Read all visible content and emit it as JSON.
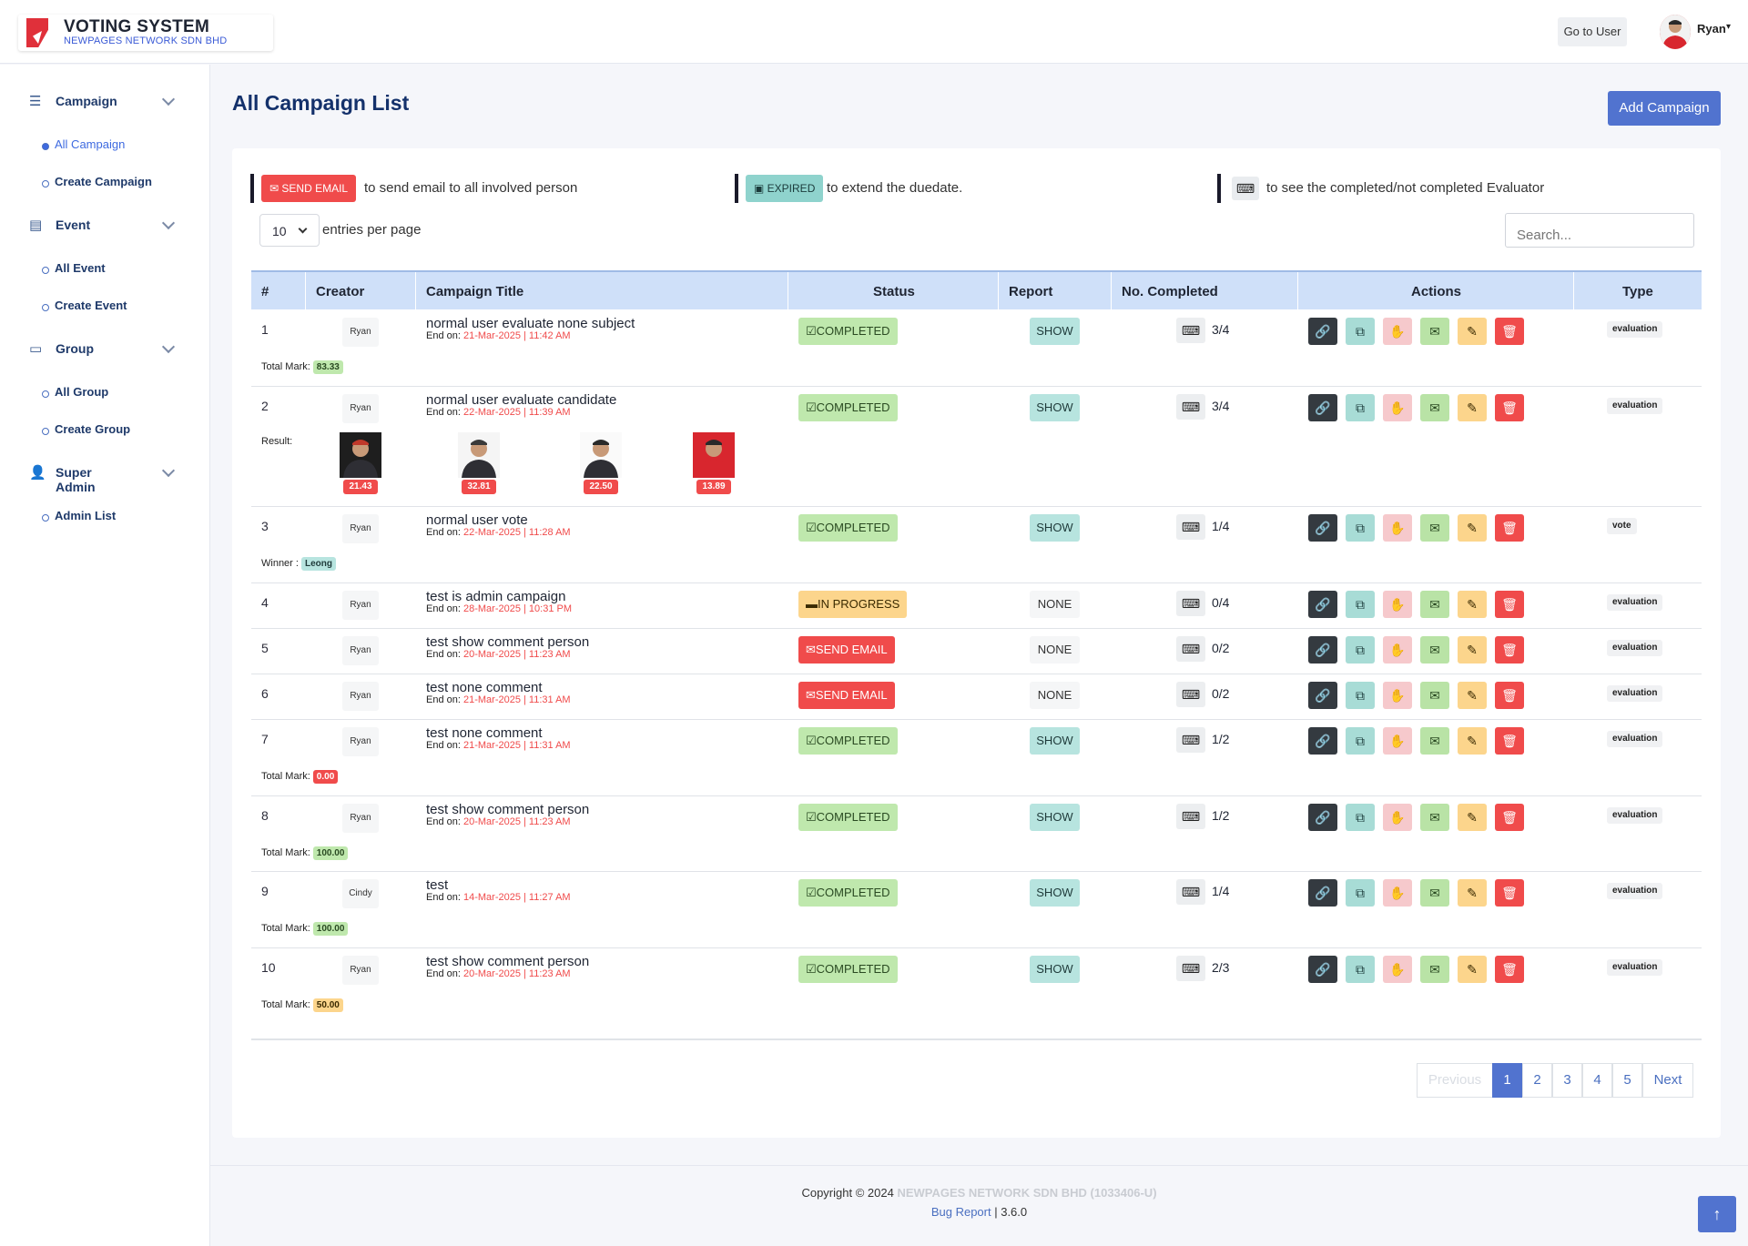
{
  "header": {
    "app_title": "VOTING SYSTEM",
    "company": "NEWPAGES NETWORK SDN BHD",
    "goto_label": "Go to User",
    "user_name": "Ryan"
  },
  "sidebar": {
    "sections": [
      {
        "label": "Campaign",
        "icon": "list-icon",
        "items": [
          "All Campaign",
          "Create Campaign"
        ]
      },
      {
        "label": "Event",
        "icon": "calendar-icon",
        "items": [
          "All Event",
          "Create Event"
        ]
      },
      {
        "label": "Group",
        "icon": "box-icon",
        "items": [
          "All Group",
          "Create Group"
        ]
      },
      {
        "label": "Super Admin",
        "icon": "admin-icon",
        "items": [
          "Admin List"
        ]
      }
    ]
  },
  "main": {
    "title": "All Campaign List",
    "add_label": "Add Campaign",
    "legend": {
      "send_label": "SEND EMAIL",
      "send_text": "to send email to all involved person",
      "expired_label": "EXPIRED",
      "expired_text": "to extend the duedate.",
      "evaluator_text": "to see the completed/not completed Evaluator"
    },
    "entries_value": "10",
    "entries_text": "entries per page",
    "search_placeholder": "Search..."
  },
  "table": {
    "columns": [
      "#",
      "Creator",
      "Campaign Title",
      "Status",
      "Report",
      "No. Completed",
      "Actions",
      "Type"
    ],
    "end_prefix": "End on:",
    "rows": [
      {
        "n": "1",
        "creator": "Ryan",
        "title": "normal user evaluate none subject",
        "end": "21-Mar-2025 | 11:42 AM",
        "status": "COMPLETED",
        "report": "SHOW",
        "completed": "3/4",
        "type": "evaluation",
        "extra_label": "Total Mark:",
        "extra_value": "83.33"
      },
      {
        "n": "2",
        "creator": "Ryan",
        "title": "normal user evaluate candidate",
        "end": "22-Mar-2025 | 11:39 AM",
        "status": "COMPLETED",
        "report": "SHOW",
        "completed": "3/4",
        "type": "evaluation",
        "extra_label": "Result:",
        "scores": [
          "21.43",
          "32.81",
          "22.50",
          "13.89"
        ]
      },
      {
        "n": "3",
        "creator": "Ryan",
        "title": "normal user vote",
        "end": "22-Mar-2025 | 11:28 AM",
        "status": "COMPLETED",
        "report": "SHOW",
        "completed": "1/4",
        "type": "vote",
        "extra_label": "Winner :",
        "extra_value": "Leong"
      },
      {
        "n": "4",
        "creator": "Ryan",
        "title": "test is admin campaign",
        "end": "28-Mar-2025 | 10:31 PM",
        "status": "IN PROGRESS",
        "report": "NONE",
        "completed": "0/4",
        "type": "evaluation"
      },
      {
        "n": "5",
        "creator": "Ryan",
        "title": "test show comment person",
        "end": "20-Mar-2025 | 11:23 AM",
        "status": "SEND EMAIL",
        "report": "NONE",
        "completed": "0/2",
        "type": "evaluation"
      },
      {
        "n": "6",
        "creator": "Ryan",
        "title": "test none comment",
        "end": "21-Mar-2025 | 11:31 AM",
        "status": "SEND EMAIL",
        "report": "NONE",
        "completed": "0/2",
        "type": "evaluation"
      },
      {
        "n": "7",
        "creator": "Ryan",
        "title": "test none comment",
        "end": "21-Mar-2025 | 11:31 AM",
        "status": "COMPLETED",
        "report": "SHOW",
        "completed": "1/2",
        "type": "evaluation",
        "extra_label": "Total Mark:",
        "extra_value": "0.00"
      },
      {
        "n": "8",
        "creator": "Ryan",
        "title": "test show comment person",
        "end": "20-Mar-2025 | 11:23 AM",
        "status": "COMPLETED",
        "report": "SHOW",
        "completed": "1/2",
        "type": "evaluation",
        "extra_label": "Total Mark:",
        "extra_value": "100.00"
      },
      {
        "n": "9",
        "creator": "Cindy",
        "title": "test",
        "end": "14-Mar-2025 | 11:27 AM",
        "status": "COMPLETED",
        "report": "SHOW",
        "completed": "1/4",
        "type": "evaluation",
        "extra_label": "Total Mark:",
        "extra_value": "100.00"
      },
      {
        "n": "10",
        "creator": "Ryan",
        "title": "test show comment person",
        "end": "20-Mar-2025 | 11:23 AM",
        "status": "COMPLETED",
        "report": "SHOW",
        "completed": "2/3",
        "type": "evaluation",
        "extra_label": "Total Mark:",
        "extra_value": "50.00"
      }
    ]
  },
  "pagination": {
    "prev": "Previous",
    "pages": [
      "1",
      "2",
      "3",
      "4",
      "5"
    ],
    "next": "Next",
    "current": "1"
  },
  "footer": {
    "copyright": "Copyright © 2024",
    "company": "NEWPAGES NETWORK SDN BHD (1033406-U)",
    "bug_label": "Bug Report",
    "version": "3.6.0"
  },
  "colors": {
    "primary": "#5173cf",
    "danger": "#f04b4b",
    "success": "#bfe8ad",
    "warning": "#fcd58c",
    "info": "#b7e4df"
  }
}
